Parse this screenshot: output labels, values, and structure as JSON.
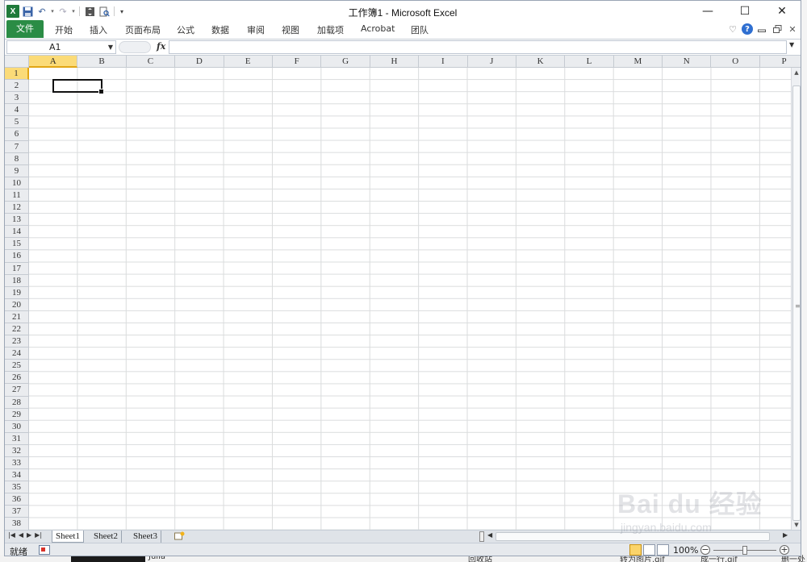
{
  "app": {
    "title": "工作簿1 - Microsoft Excel"
  },
  "window_controls": {
    "minimize": "—",
    "maximize": "☐",
    "close": "✕"
  },
  "ribbon": {
    "file_tab": "文件",
    "tabs": [
      "开始",
      "插入",
      "页面布局",
      "公式",
      "数据",
      "审阅",
      "视图",
      "加载项",
      "Acrobat",
      "团队"
    ]
  },
  "formula_bar": {
    "name_box": "A1",
    "fx_label": "fx",
    "value": ""
  },
  "grid": {
    "columns": [
      "A",
      "B",
      "C",
      "D",
      "E",
      "F",
      "G",
      "H",
      "I",
      "J",
      "K",
      "L",
      "M",
      "N",
      "O",
      "P"
    ],
    "rows": [
      "1",
      "2",
      "3",
      "4",
      "5",
      "6",
      "7",
      "8",
      "9",
      "10",
      "11",
      "12",
      "13",
      "14",
      "15",
      "16",
      "17",
      "18",
      "19",
      "20",
      "21",
      "22",
      "23",
      "24",
      "25",
      "26",
      "27",
      "28",
      "29",
      "30",
      "31",
      "32",
      "33",
      "34",
      "35",
      "36",
      "37",
      "38"
    ],
    "active_cell": "A1"
  },
  "sheets": {
    "tabs": [
      "Sheet1",
      "Sheet2",
      "Sheet3"
    ],
    "active": "Sheet1"
  },
  "status_bar": {
    "status": "就绪",
    "zoom": "100%"
  },
  "watermark": {
    "main": "Bai du 经验",
    "sub": "jingyan.baidu.com"
  },
  "background_taskbar": [
    "Julia",
    "回收站",
    "转为图片.gif",
    "成一行.gif",
    "删一处"
  ],
  "colors": {
    "file_tab": "#2a8c45",
    "selected_header": "#fbdb78",
    "gridline": "#dadcdd"
  }
}
